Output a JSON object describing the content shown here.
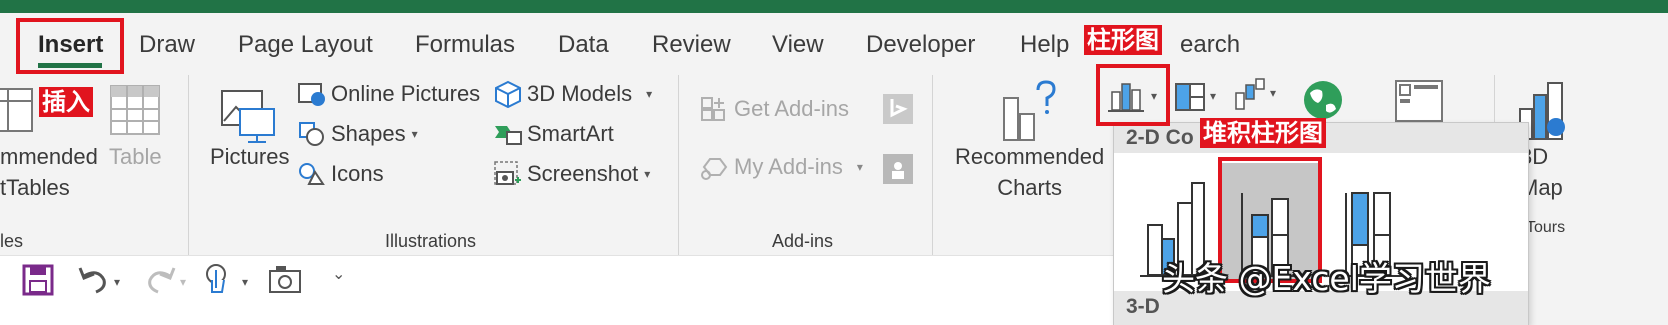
{
  "tabs": [
    "Insert",
    "Draw",
    "Page Layout",
    "Formulas",
    "Data",
    "Review",
    "View",
    "Developer",
    "Help",
    "earch"
  ],
  "ribbon": {
    "tables": {
      "recommended_line1": "mmended",
      "recommended_line2": "tTables",
      "table": "Table",
      "group": "les"
    },
    "illustrations": {
      "pictures": "Pictures",
      "online_pictures": "Online Pictures",
      "shapes": "Shapes",
      "icons": "Icons",
      "models_3d": "3D Models",
      "smartart": "SmartArt",
      "screenshot": "Screenshot",
      "group": "Illustrations"
    },
    "addins": {
      "get_addins": "Get Add-ins",
      "my_addins": "My Add-ins",
      "group": "Add-ins"
    },
    "charts": {
      "recommended_line1": "Recommended",
      "recommended_line2": "Charts"
    },
    "tours": {
      "map_line1": "3D",
      "map_line2": "Map",
      "group": "Tours"
    }
  },
  "dropdown": {
    "header": "2-D Co",
    "header2": "3-D"
  },
  "annotations": {
    "insert": "插入",
    "column": "柱形图",
    "stacked_column": "堆积柱形图"
  },
  "watermark": "头条 @Excel学习世界",
  "colors": {
    "excel_green": "#217346",
    "annotation_red": "#e1141e",
    "chart_blue": "#4da3e8"
  }
}
